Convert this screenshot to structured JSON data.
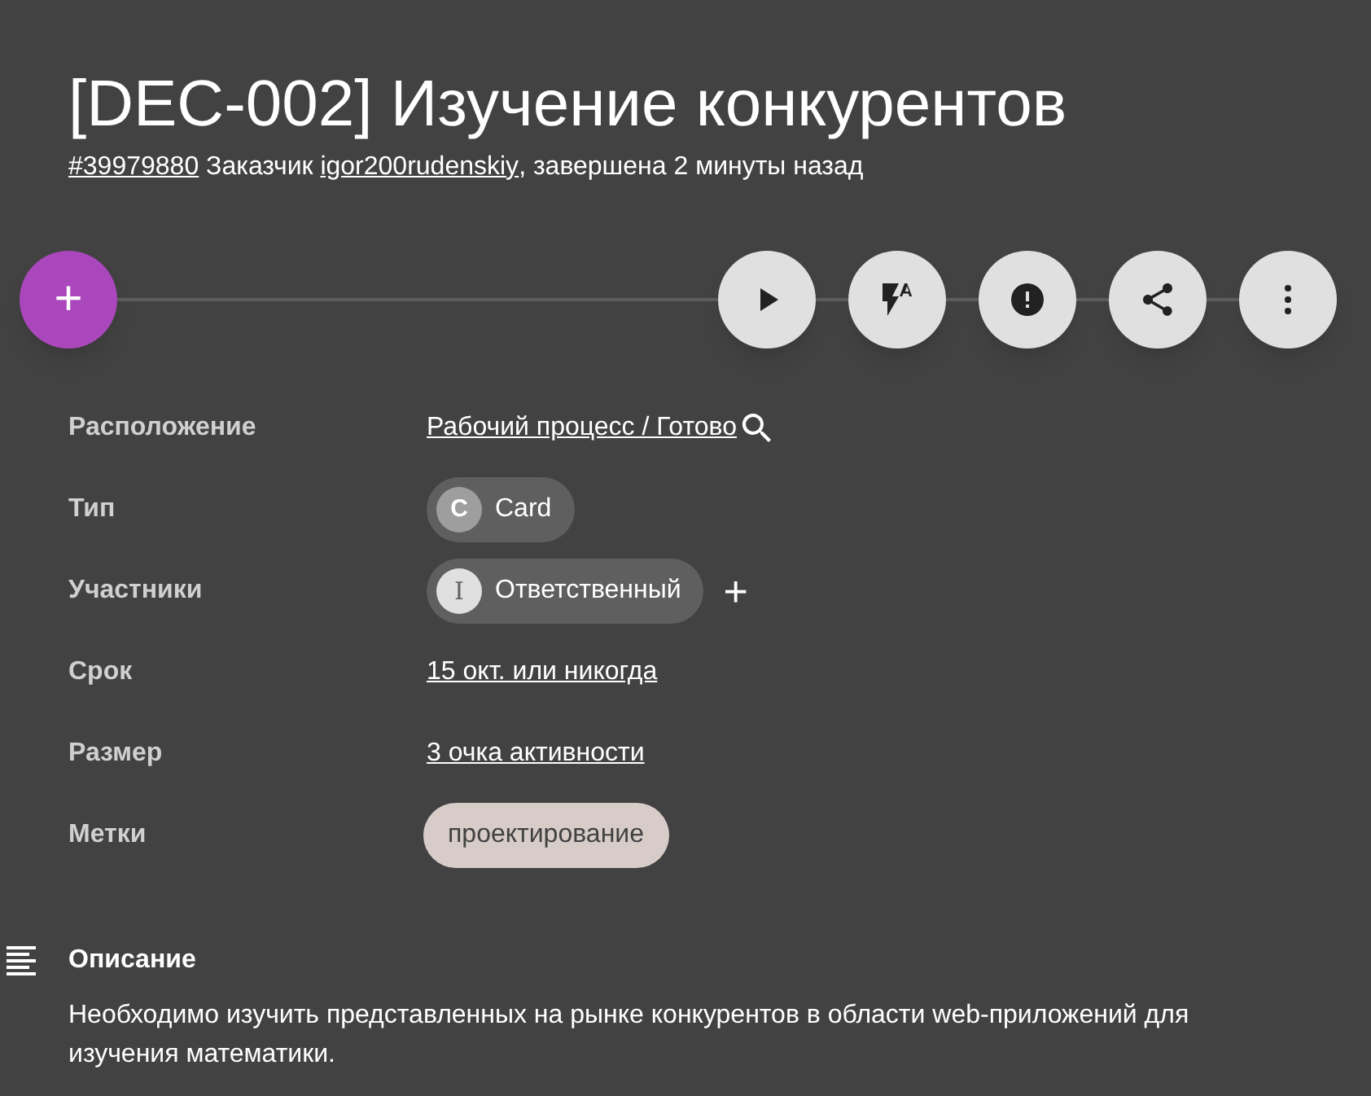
{
  "title": "[DEC-002] Изучение конкурентов",
  "subtitle": [
    {
      "kind": "link",
      "text": "#39979880"
    },
    {
      "kind": "text",
      "text": " Заказчик "
    },
    {
      "kind": "link",
      "text": "igor200rudenskiy"
    },
    {
      "kind": "text",
      "text": ", завершена 2 минуты назад"
    }
  ],
  "toolbar": {
    "add_button": "+",
    "actions": [
      {
        "kind": "play"
      },
      {
        "kind": "flash"
      },
      {
        "kind": "alert"
      },
      {
        "kind": "share"
      },
      {
        "kind": "more"
      }
    ]
  },
  "fields": [
    {
      "label": "Расположение",
      "kind": "link",
      "value": "Рабочий процесс / Готово",
      "search": true
    },
    {
      "label": "Тип",
      "kind": "chip",
      "avatar": "C",
      "value": "Card"
    },
    {
      "label": "Участники",
      "kind": "chip",
      "avatar": "I",
      "value": "Ответственный",
      "add": "+"
    },
    {
      "label": "Срок",
      "kind": "link",
      "value": "15 окт. или никогда"
    },
    {
      "label": "Размер",
      "kind": "link",
      "value": "3 очка активности"
    },
    {
      "label": "Метки",
      "kind": "tag",
      "value": "проектирование"
    }
  ],
  "description": {
    "heading": "Описание",
    "text": "Необходимо изучить представленных на рынке конкурентов в области web-приложений для изучения математики."
  }
}
